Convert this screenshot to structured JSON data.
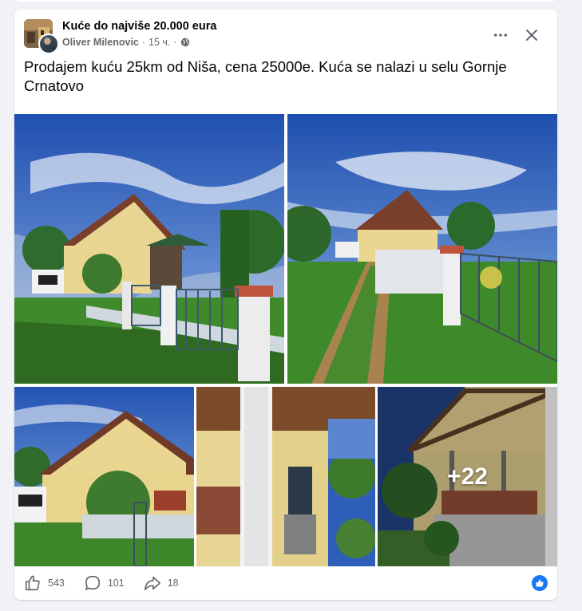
{
  "group": {
    "name": "Kuće do najviše 20.000 eura"
  },
  "post": {
    "author": "Oliver Milenovic",
    "time": "15 ч.",
    "separator": "·",
    "text": "Prodajem kuću 25km od Niša, cena 25000e. Kuća se nalazi u selu Gornje Crnatovo"
  },
  "photos": {
    "more_count": "+22"
  },
  "stats": {
    "likes": "543",
    "comments": "101",
    "shares": "18"
  },
  "icons": {
    "privacy": "globe-icon",
    "menu": "more-horizontal-icon",
    "close": "close-icon",
    "like": "thumbs-up-icon",
    "comment": "comment-bubble-icon",
    "share": "share-arrow-icon",
    "share_action": "share-icon"
  },
  "colors": {
    "accent": "#1877f2",
    "secondary_text": "#65676b",
    "background": "#f0f2f5"
  }
}
